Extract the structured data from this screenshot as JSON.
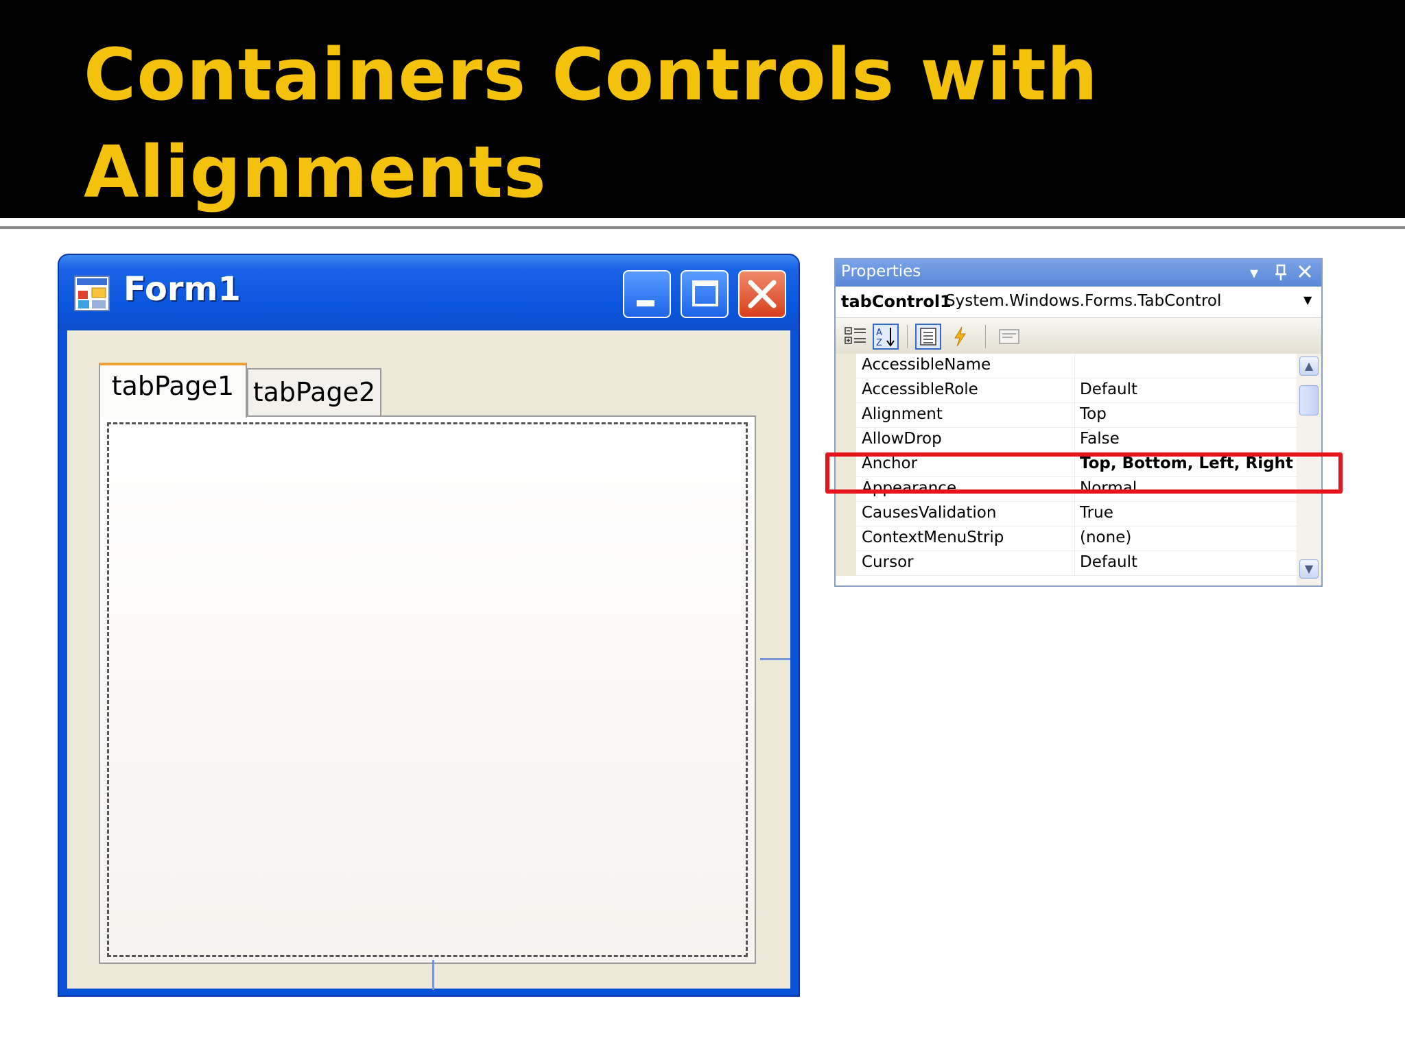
{
  "slide": {
    "title_line1": "Containers Controls with",
    "title_line2": "Alignments"
  },
  "form": {
    "title": "Form1",
    "tabs": [
      {
        "label": "tabPage1",
        "selected": true
      },
      {
        "label": "tabPage2",
        "selected": false
      }
    ]
  },
  "properties": {
    "panel_title": "Properties",
    "object_name": "tabControl1",
    "object_type": "System.Windows.Forms.TabControl",
    "rows": [
      {
        "name": "AccessibleName",
        "value": ""
      },
      {
        "name": "AccessibleRole",
        "value": "Default"
      },
      {
        "name": "Alignment",
        "value": "Top"
      },
      {
        "name": "AllowDrop",
        "value": "False"
      },
      {
        "name": "Anchor",
        "value": "Top, Bottom, Left, Right"
      },
      {
        "name": "Appearance",
        "value": "Normal"
      },
      {
        "name": "CausesValidation",
        "value": "True"
      },
      {
        "name": "ContextMenuStrip",
        "value": "(none)"
      },
      {
        "name": "Cursor",
        "value": "Default"
      }
    ],
    "highlighted_row": "Anchor"
  },
  "colors": {
    "title_yellow": "#f4c20d",
    "xp_blue": "#0a52d8",
    "highlight_red": "#e8141c"
  }
}
